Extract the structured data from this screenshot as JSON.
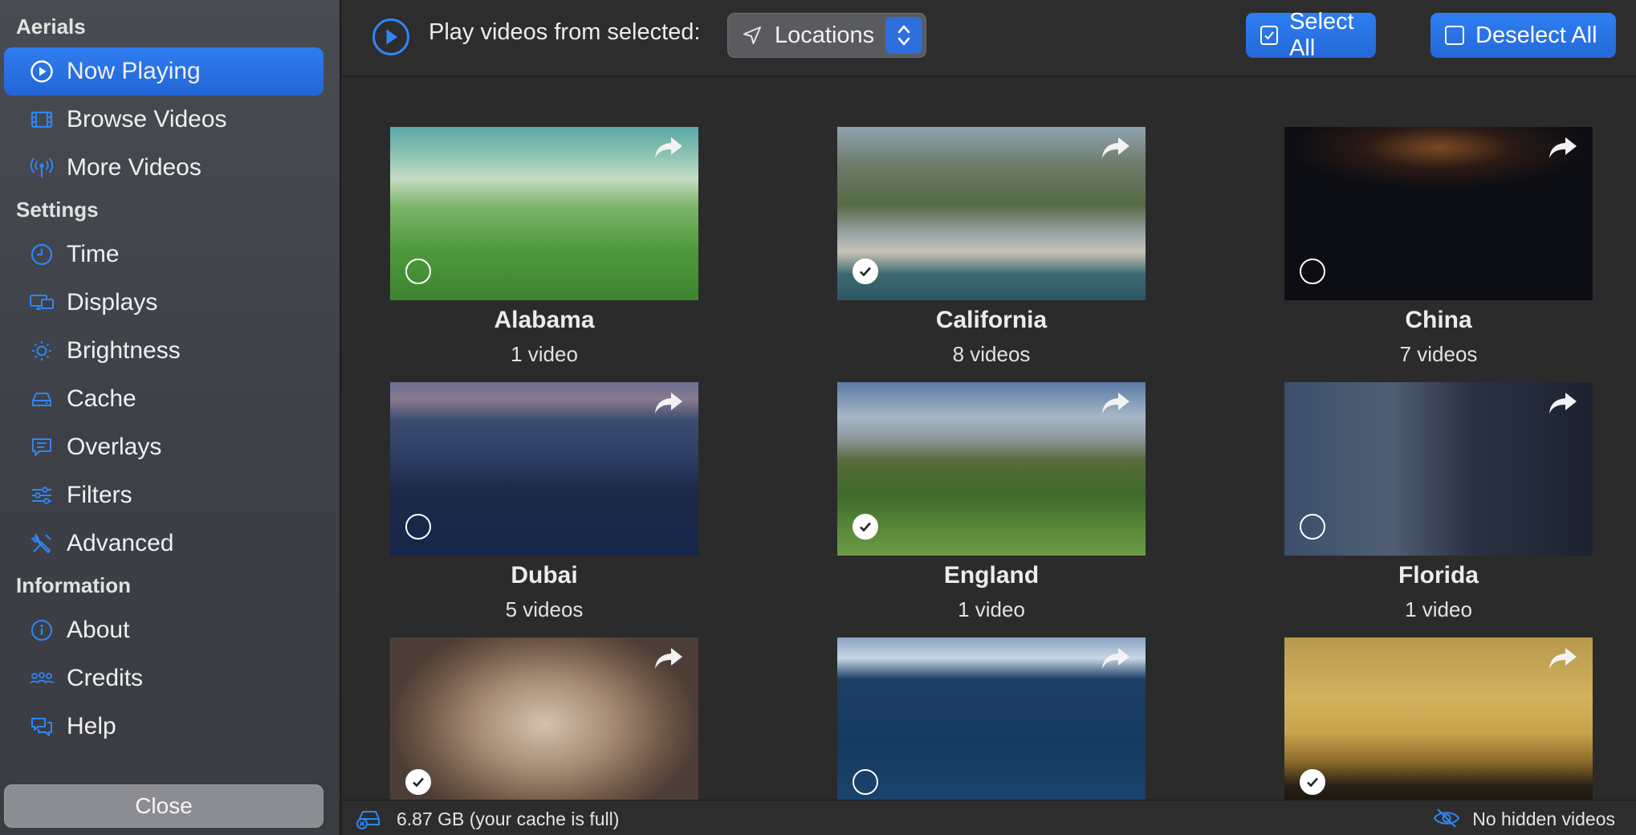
{
  "sidebar": {
    "sections": {
      "aerials": "Aerials",
      "settings": "Settings",
      "information": "Information"
    },
    "items": [
      {
        "label": "Now Playing",
        "icon": "play-circle-icon"
      },
      {
        "label": "Browse Videos",
        "icon": "film-icon"
      },
      {
        "label": "More Videos",
        "icon": "antenna-icon"
      },
      {
        "label": "Time",
        "icon": "clock-icon"
      },
      {
        "label": "Displays",
        "icon": "displays-icon"
      },
      {
        "label": "Brightness",
        "icon": "sun-icon"
      },
      {
        "label": "Cache",
        "icon": "drive-icon"
      },
      {
        "label": "Overlays",
        "icon": "speech-bubble-icon"
      },
      {
        "label": "Filters",
        "icon": "sliders-icon"
      },
      {
        "label": "Advanced",
        "icon": "tools-icon"
      },
      {
        "label": "About",
        "icon": "info-icon"
      },
      {
        "label": "Credits",
        "icon": "people-icon"
      },
      {
        "label": "Help",
        "icon": "help-bubbles-icon"
      }
    ],
    "close_label": "Close"
  },
  "toolbar": {
    "play_label": "Play videos from selected:",
    "source_value": "Locations",
    "select_all": "Select All",
    "deselect_all": "Deselect All"
  },
  "cards": [
    {
      "name": "Alabama",
      "count": "1 video",
      "selected": false
    },
    {
      "name": "California",
      "count": "8 videos",
      "selected": true
    },
    {
      "name": "China",
      "count": "7 videos",
      "selected": false
    },
    {
      "name": "Dubai",
      "count": "5 videos",
      "selected": false
    },
    {
      "name": "England",
      "count": "1 video",
      "selected": true
    },
    {
      "name": "Florida",
      "count": "1 video",
      "selected": false
    },
    {
      "name": "",
      "count": "",
      "selected": true
    },
    {
      "name": "",
      "count": "",
      "selected": false
    },
    {
      "name": "",
      "count": "",
      "selected": true
    }
  ],
  "status": {
    "cache": "6.87 GB (your cache is full)",
    "hidden": "No hidden videos"
  },
  "colors": {
    "accent": "#2a72e6",
    "sidebar": "#44474e",
    "background": "#2b2b2b"
  }
}
